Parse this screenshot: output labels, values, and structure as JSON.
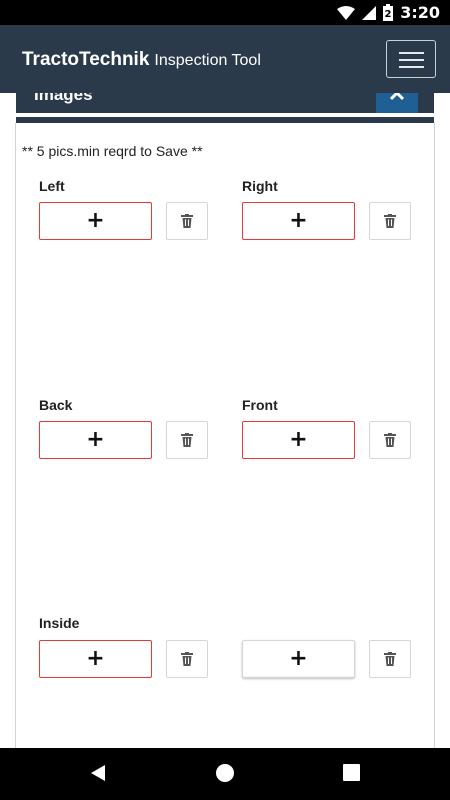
{
  "status_bar": {
    "time": "3:20",
    "battery_level": "2"
  },
  "app_bar": {
    "brand_bold": "TractoTechnik",
    "brand_light": "Inspection Tool",
    "menu_icon": "hamburger-icon"
  },
  "modal": {
    "title": "Images",
    "close_icon": "close-icon"
  },
  "note": "** 5 pics.min reqrd to Save **",
  "slots": [
    {
      "label": "Left",
      "add_label": "+"
    },
    {
      "label": "Right",
      "add_label": "+"
    },
    {
      "label": "Back",
      "add_label": "+"
    },
    {
      "label": "Front",
      "add_label": "+"
    },
    {
      "label": "Inside",
      "add_label": "+"
    },
    {
      "label": "",
      "add_label": "+"
    }
  ],
  "icons": {
    "delete": "trash-icon",
    "back": "back-icon",
    "home": "home-icon",
    "recents": "recents-icon"
  },
  "colors": {
    "app_bar": "#2b3a4a",
    "required_border": "#e53935",
    "close_button": "#1f5f94"
  }
}
